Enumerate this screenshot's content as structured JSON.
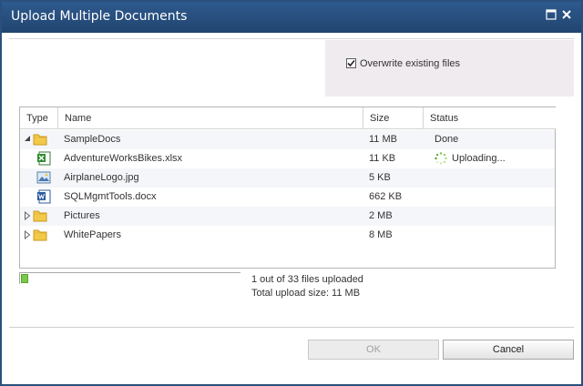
{
  "window": {
    "title": "Upload Multiple Documents"
  },
  "icons": {
    "maximize": "maximize-icon",
    "close": "close-icon"
  },
  "options": {
    "overwrite_label": "Overwrite existing files",
    "overwrite_checked": true
  },
  "table": {
    "columns": [
      "Type",
      "Name",
      "Size",
      "Status"
    ],
    "rows": [
      {
        "icon": "folder-icon",
        "expander": "expanded",
        "name": "SampleDocs",
        "size": "11 MB",
        "status": "Done"
      },
      {
        "icon": "excel-file-icon",
        "expander": "",
        "name": "AdventureWorksBikes.xlsx",
        "size": "11 KB",
        "status": "Uploading..."
      },
      {
        "icon": "image-file-icon",
        "expander": "",
        "name": "AirplaneLogo.jpg",
        "size": "5 KB",
        "status": ""
      },
      {
        "icon": "word-file-icon",
        "expander": "",
        "name": "SQLMgmtTools.docx",
        "size": "662 KB",
        "status": ""
      },
      {
        "icon": "folder-icon",
        "expander": "collapsed",
        "name": "Pictures",
        "size": "2 MB",
        "status": ""
      },
      {
        "icon": "folder-icon",
        "expander": "collapsed",
        "name": "WhitePapers",
        "size": "8 MB",
        "status": ""
      }
    ]
  },
  "progress": {
    "fraction": 0.03,
    "files_text": "1 out of 33 files uploaded",
    "size_text": "Total upload size: 11 MB"
  },
  "buttons": {
    "ok": "OK",
    "cancel": "Cancel"
  },
  "colors": {
    "titlebar": "#2b4f7e",
    "progress": "#79c84a",
    "panel": "#f0ebef"
  }
}
